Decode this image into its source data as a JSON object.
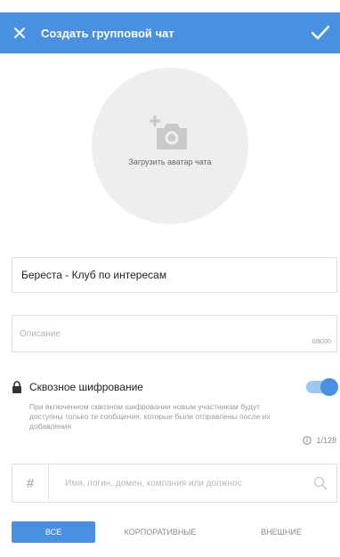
{
  "header": {
    "title": "Создать групповой чат",
    "close_icon": "close-icon",
    "confirm_icon": "check-icon",
    "bg_color": "#4a90e2"
  },
  "avatar": {
    "icon": "add-photo-icon",
    "label": "Загрузить аватар чата"
  },
  "name_field": {
    "value": "Береста - Клуб по интересам"
  },
  "description_field": {
    "placeholder": "Описание",
    "counter": "0/8000"
  },
  "encryption": {
    "label": "Сквозное шифрование",
    "enabled": true,
    "hint": "При включенном сквозном шифровании новым участникам будут доступны только те сообщения, которые были отправлены после их добавления",
    "limit": "1/128"
  },
  "search": {
    "prefix": "#",
    "placeholder": "Имя, логин, домен, компания или должнос"
  },
  "tabs": [
    {
      "label": "Все",
      "active": true
    },
    {
      "label": "Корпоративные",
      "active": false
    },
    {
      "label": "Внешние",
      "active": false
    }
  ],
  "colors": {
    "accent": "#4a90e2",
    "toggle_track": "#9ec6f3",
    "avatar_bg": "#eeeeee"
  }
}
